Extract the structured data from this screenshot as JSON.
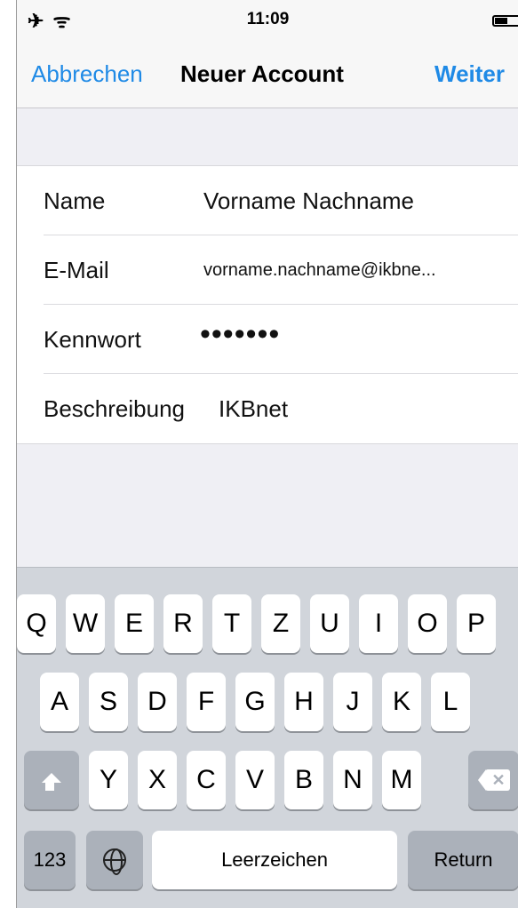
{
  "status_bar": {
    "left_icons": "✈ ᯤ",
    "time": "11:09",
    "battery_icon": "battery-icon"
  },
  "nav": {
    "cancel_label": "Abbrechen",
    "title": "Neuer Account",
    "next_label": "Weiter"
  },
  "form": {
    "rows": [
      {
        "label": "Name",
        "value": "Vorname Nachname"
      },
      {
        "label": "E-Mail",
        "value": "vorname.nachname@ikbne..."
      },
      {
        "label": "Kennwort",
        "value": "•••••••"
      },
      {
        "label": "Beschreibung",
        "value": "IKBnet"
      }
    ]
  },
  "keyboard": {
    "row1": [
      "Q",
      "W",
      "E",
      "R",
      "T",
      "Z",
      "U",
      "I",
      "O",
      "P"
    ],
    "row2": [
      "A",
      "S",
      "D",
      "F",
      "G",
      "H",
      "J",
      "K",
      "L"
    ],
    "row3": [
      "Y",
      "X",
      "C",
      "V",
      "B",
      "N",
      "M"
    ],
    "numbers_label": "123",
    "space_label": "Leerzeichen",
    "return_label": "Return",
    "colors": {
      "key": "#ffffff",
      "dark_key": "#abb1ba",
      "background": "#d1d5db",
      "accent": "#1f8ae6"
    }
  }
}
